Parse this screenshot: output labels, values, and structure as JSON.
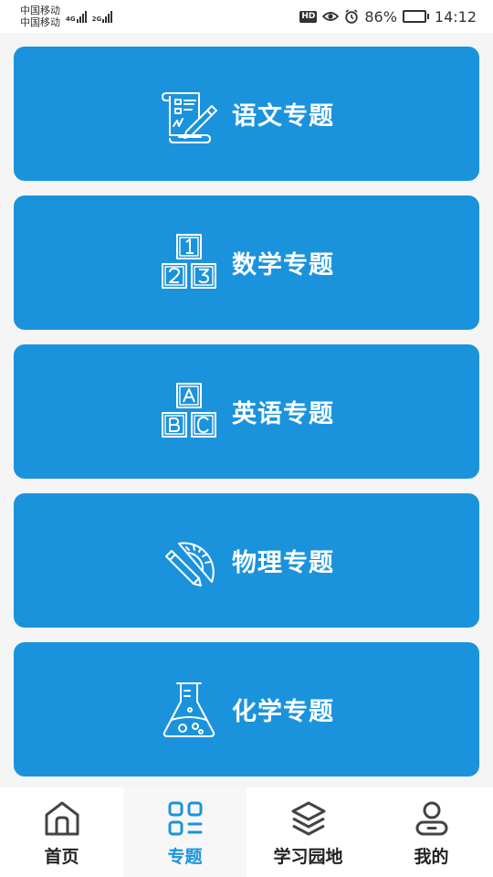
{
  "status_bar": {
    "carrier_1": "中国移动",
    "carrier_2": "中国移动",
    "net_1": "4G",
    "net_2": "2G",
    "hd": "HD",
    "battery": "86%",
    "battery_level": 0.86,
    "time": "14:12"
  },
  "subjects": [
    {
      "label": "语文专题",
      "icon": "scroll-pencil-icon"
    },
    {
      "label": "数学专题",
      "icon": "number-blocks-icon"
    },
    {
      "label": "英语专题",
      "icon": "letter-blocks-icon"
    },
    {
      "label": "物理专题",
      "icon": "protractor-pencil-icon"
    },
    {
      "label": "化学专题",
      "icon": "flask-icon"
    }
  ],
  "bottom_nav": {
    "items": [
      {
        "label": "首页",
        "icon": "home-icon",
        "active": false
      },
      {
        "label": "专题",
        "icon": "grid-list-icon",
        "active": true
      },
      {
        "label": "学习园地",
        "icon": "layers-icon",
        "active": false
      },
      {
        "label": "我的",
        "icon": "user-icon",
        "active": false
      }
    ]
  },
  "colors": {
    "card": "#1a93dc",
    "active": "#1a93dc",
    "nav_inactive": "#444444"
  }
}
